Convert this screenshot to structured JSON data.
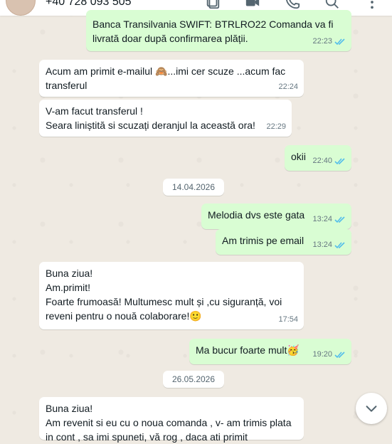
{
  "header": {
    "contact_phone": "+40 728 093 505",
    "icons": [
      "avatar",
      "gallery-icon",
      "video-call-icon",
      "phone-icon",
      "search-icon",
      "more-options-icon"
    ]
  },
  "messages": [
    {
      "direction": "out",
      "lines": [
        "Banca Transilvania SWIFT: BTRLRO22 Comanda va fi",
        "livrată doar după confirmarea plății."
      ],
      "time": "22:23",
      "read": true
    },
    {
      "direction": "in",
      "lines": [
        "Acum am primit e-mailul 🙈...imi cer scuze ...acum fac",
        "transferul"
      ],
      "time": "22:24"
    },
    {
      "direction": "in",
      "lines": [
        "V-am facut transferul !",
        "Seara liniștită si scuzați deranjul la această ora!"
      ],
      "time": "22:29"
    },
    {
      "direction": "out",
      "lines": [
        "okii"
      ],
      "time": "22:40",
      "read": true
    },
    {
      "date": "14.04.2026"
    },
    {
      "direction": "out",
      "lines": [
        "Melodia dvs este gata"
      ],
      "time": "13:24",
      "read": true
    },
    {
      "direction": "out",
      "lines": [
        "Am trimis pe email"
      ],
      "time": "13:24",
      "read": true
    },
    {
      "direction": "in",
      "lines": [
        "Buna ziua!",
        "Am.primit!",
        "Foarte frumoasă! Multumesc mult și ,cu siguranță,  voi",
        "reveni pentru o nouă colaborare!🙂"
      ],
      "time": "17:54"
    },
    {
      "direction": "out",
      "lines": [
        "Ma bucur foarte mult🥳"
      ],
      "time": "19:20",
      "read": true
    },
    {
      "date": "26.05.2026"
    },
    {
      "direction": "in",
      "lines": [
        "Buna ziua!",
        "Am revenit si eu cu o noua comanda , v- am trimis plata",
        "in cont , sa imi spuneti, vă rog , daca ati primit"
      ]
    }
  ],
  "colors": {
    "incoming": "#ffffff",
    "outgoing": "#d9fdd3",
    "tick_read": "#53bdeb",
    "wallpaper": "#efeae2"
  }
}
